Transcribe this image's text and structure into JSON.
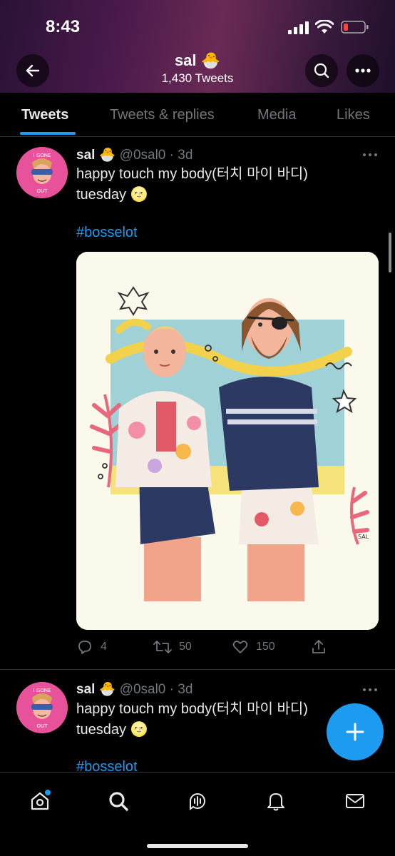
{
  "status": {
    "time": "8:43"
  },
  "header": {
    "name": "sal",
    "name_emoji": "🐣",
    "tweet_count": "1,430 Tweets"
  },
  "tabs": [
    {
      "label": "Tweets",
      "active": true
    },
    {
      "label": "Tweets & replies",
      "active": false
    },
    {
      "label": "Media",
      "active": false
    },
    {
      "label": "Likes",
      "active": false
    }
  ],
  "tweets": [
    {
      "name": "sal",
      "emoji": "🐣",
      "handle": "@0sal0 · 3d",
      "text_line1": "happy touch my body(터치 마이 바디)",
      "text_line2": "tuesday 🌝",
      "hashtag": "#bosselot",
      "avatar_text": "I GONE STICKING OUT",
      "replies": "4",
      "retweets": "50",
      "likes": "150"
    },
    {
      "name": "sal",
      "emoji": "🐣",
      "handle": "@0sal0 · 3d",
      "text_line1": "happy touch my body(터치 마이 바디)",
      "text_line2": "tuesday 🌝",
      "hashtag": "#bosselot",
      "avatar_text": "I GONE STICKING OUT"
    }
  ],
  "media": {
    "signature": "SAL"
  },
  "colors": {
    "accent": "#1d9bf0",
    "background": "#000000",
    "secondary_text": "#71767b"
  },
  "icons": [
    "back-arrow-icon",
    "search-icon",
    "more-icon",
    "ellipsis-icon",
    "reply-icon",
    "retweet-icon",
    "like-icon",
    "share-icon",
    "compose-icon",
    "home-icon",
    "explore-icon",
    "spaces-icon",
    "notifications-icon",
    "messages-icon"
  ]
}
